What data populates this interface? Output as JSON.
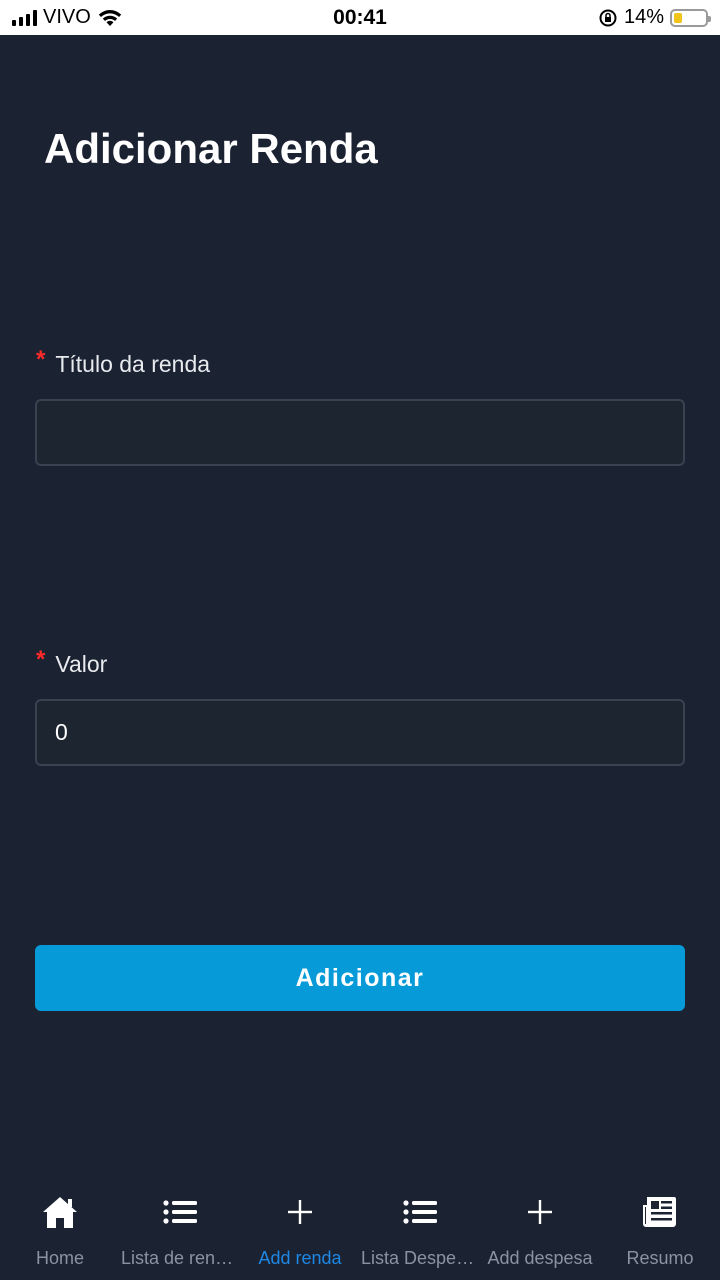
{
  "status_bar": {
    "carrier": "VIVO",
    "time": "00:41",
    "battery_percent": "14%",
    "battery_level": 0.14
  },
  "page": {
    "title": "Adicionar Renda"
  },
  "form": {
    "title_field": {
      "required_mark": "*",
      "label": "Título da renda",
      "value": "",
      "placeholder": ""
    },
    "value_field": {
      "required_mark": "*",
      "label": "Valor",
      "value": "0"
    },
    "submit_label": "Adicionar"
  },
  "bottom_nav": {
    "items": [
      {
        "label": "Home",
        "icon": "home-icon"
      },
      {
        "label": "Lista de rendas",
        "icon": "list-icon"
      },
      {
        "label": "Add renda",
        "icon": "plus-icon",
        "active": true
      },
      {
        "label": "Lista Despesas",
        "icon": "list-icon"
      },
      {
        "label": "Add despesa",
        "icon": "plus-icon"
      },
      {
        "label": "Resumo",
        "icon": "newspaper-icon"
      }
    ]
  },
  "colors": {
    "background": "#1b2232",
    "accent": "#069ad8",
    "active_tab": "#1e88e5",
    "required": "#ff2a2a"
  }
}
